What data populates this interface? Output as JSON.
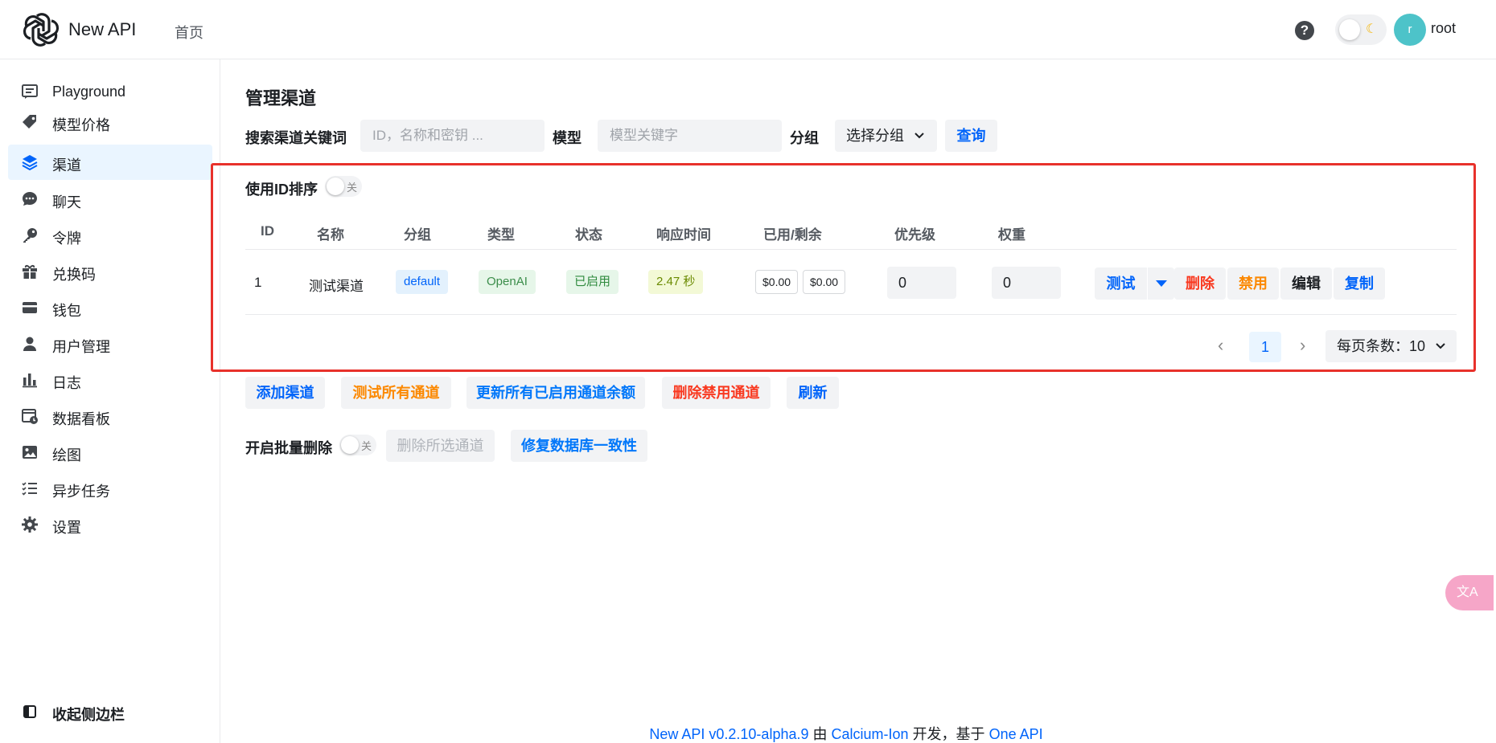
{
  "header": {
    "app_title": "New API",
    "nav_home": "首页",
    "help_glyph": "?",
    "avatar_initial": "r",
    "username": "root",
    "icons": [
      "openai-logo-icon",
      "help-icon",
      "moon-icon"
    ]
  },
  "sidebar": {
    "items": [
      {
        "label": "Playground",
        "icon": "chat-box-icon"
      },
      {
        "label": "模型价格",
        "icon": "price-tag-icon"
      },
      {
        "label": "渠道",
        "icon": "layers-icon",
        "active": true
      },
      {
        "label": "聊天",
        "icon": "chat-bubble-icon"
      },
      {
        "label": "令牌",
        "icon": "key-icon"
      },
      {
        "label": "兑换码",
        "icon": "gift-icon"
      },
      {
        "label": "钱包",
        "icon": "credit-card-icon"
      },
      {
        "label": "用户管理",
        "icon": "user-icon"
      },
      {
        "label": "日志",
        "icon": "bar-chart-icon"
      },
      {
        "label": "数据看板",
        "icon": "calendar-clock-icon"
      },
      {
        "label": "绘图",
        "icon": "image-icon"
      },
      {
        "label": "异步任务",
        "icon": "task-list-icon"
      },
      {
        "label": "设置",
        "icon": "gear-icon"
      }
    ],
    "collapse_label": "收起侧边栏"
  },
  "main": {
    "title": "管理渠道",
    "search": {
      "keyword_label": "搜索渠道关键词",
      "keyword_placeholder": "ID，名称和密钥 ...",
      "model_label": "模型",
      "model_placeholder": "模型关键字",
      "group_label": "分组",
      "group_select": "选择分组",
      "query_button": "查询"
    },
    "sort_by_id_label": "使用ID排序",
    "sort_switch_text": "关",
    "table": {
      "columns": [
        "ID",
        "名称",
        "分组",
        "类型",
        "状态",
        "响应时间",
        "已用/剩余",
        "优先级",
        "权重"
      ],
      "rows": [
        {
          "id": "1",
          "name": "测试渠道",
          "group": "default",
          "type": "OpenAI",
          "status": "已启用",
          "response_time": "2.47 秒",
          "used": "$0.00",
          "remaining": "$0.00",
          "priority": "0",
          "weight": "0",
          "actions": {
            "test": "测试",
            "delete": "删除",
            "disable": "禁用",
            "edit": "编辑",
            "copy": "复制"
          }
        }
      ]
    },
    "pagination": {
      "current_page": "1",
      "page_size_label": "每页条数：10"
    },
    "actions": {
      "add_channel": "添加渠道",
      "test_all": "测试所有通道",
      "update_balances": "更新所有已启用通道余额",
      "delete_disabled": "删除禁用通道",
      "refresh": "刷新"
    },
    "batch": {
      "label": "开启批量删除",
      "switch_text": "关",
      "delete_selected": "删除所选通道",
      "fix_db": "修复数据库一致性"
    }
  },
  "footer": {
    "version_link": "New API v0.2.10-alpha.9",
    "by": "由",
    "author_link": "Calcium-Ion",
    "dev_based": "开发，基于",
    "one_api_link": "One API"
  },
  "translate_fab": "文A",
  "colors": {
    "primary": "#0064fa",
    "orange": "#fc8800",
    "red": "#f93920",
    "highlight_box": "#e8312b",
    "active_bg": "#eaf5ff"
  }
}
